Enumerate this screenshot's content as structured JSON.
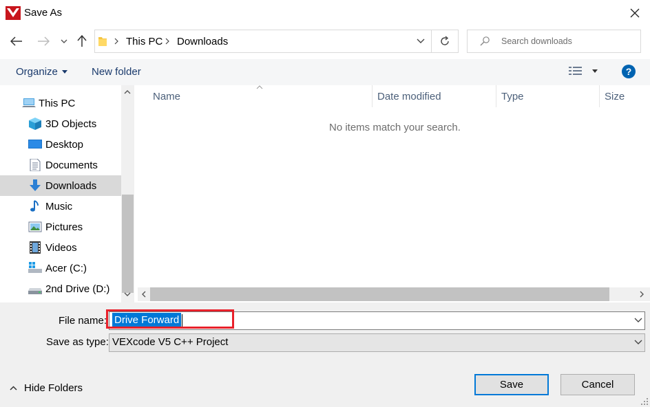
{
  "window": {
    "title": "Save As"
  },
  "address": {
    "segments": [
      "This PC",
      "Downloads"
    ]
  },
  "search": {
    "placeholder": "Search downloads"
  },
  "toolbar": {
    "organize_label": "Organize",
    "new_folder_label": "New folder"
  },
  "sidebar": {
    "items": [
      {
        "label": "This PC",
        "icon": "computer-icon"
      },
      {
        "label": "3D Objects",
        "icon": "cube-icon"
      },
      {
        "label": "Desktop",
        "icon": "desktop-icon"
      },
      {
        "label": "Documents",
        "icon": "document-icon"
      },
      {
        "label": "Downloads",
        "icon": "download-arrow-icon"
      },
      {
        "label": "Music",
        "icon": "music-note-icon"
      },
      {
        "label": "Pictures",
        "icon": "picture-icon"
      },
      {
        "label": "Videos",
        "icon": "film-icon"
      },
      {
        "label": "Acer (C:)",
        "icon": "drive-windows-icon"
      },
      {
        "label": "2nd Drive (D:)",
        "icon": "drive-icon"
      }
    ],
    "selected": "Downloads"
  },
  "columns": [
    "Name",
    "Date modified",
    "Type",
    "Size"
  ],
  "empty_message": "No items match your search.",
  "form": {
    "file_name_label": "File name:",
    "file_name_value": "Drive Forward",
    "save_type_label": "Save as type:",
    "save_type_value": "VEXcode V5 C++ Project"
  },
  "footer": {
    "hide_folders_label": "Hide Folders",
    "save_label": "Save",
    "cancel_label": "Cancel"
  },
  "colors": {
    "accent": "#0078d7",
    "highlight": "#e8202a",
    "logo": "#c8161d"
  }
}
